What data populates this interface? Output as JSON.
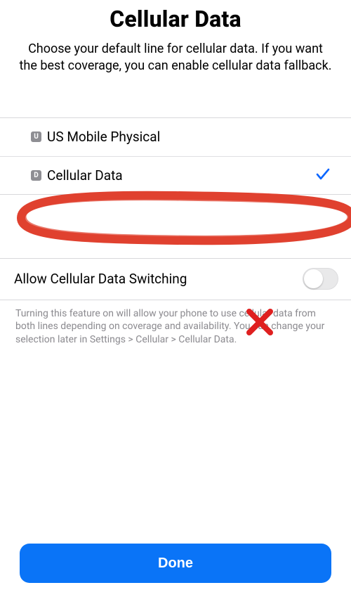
{
  "header": {
    "title": "Cellular Data",
    "subtitle": "Choose your default line for cellular data. If you want the best coverage, you can enable cellular data fallback."
  },
  "lines": {
    "option0": {
      "badge": "U",
      "label": "US Mobile Physical"
    },
    "option1": {
      "badge": "D",
      "label": "Cellular Data",
      "selected": true
    }
  },
  "switch": {
    "label": "Allow Cellular Data Switching",
    "on": false
  },
  "footer": {
    "text": "Turning this feature on will allow your phone to use cellular data from both lines depending on coverage and availability. You can change your selection later in Settings > Cellular > Cellular Data."
  },
  "buttons": {
    "done": "Done"
  }
}
